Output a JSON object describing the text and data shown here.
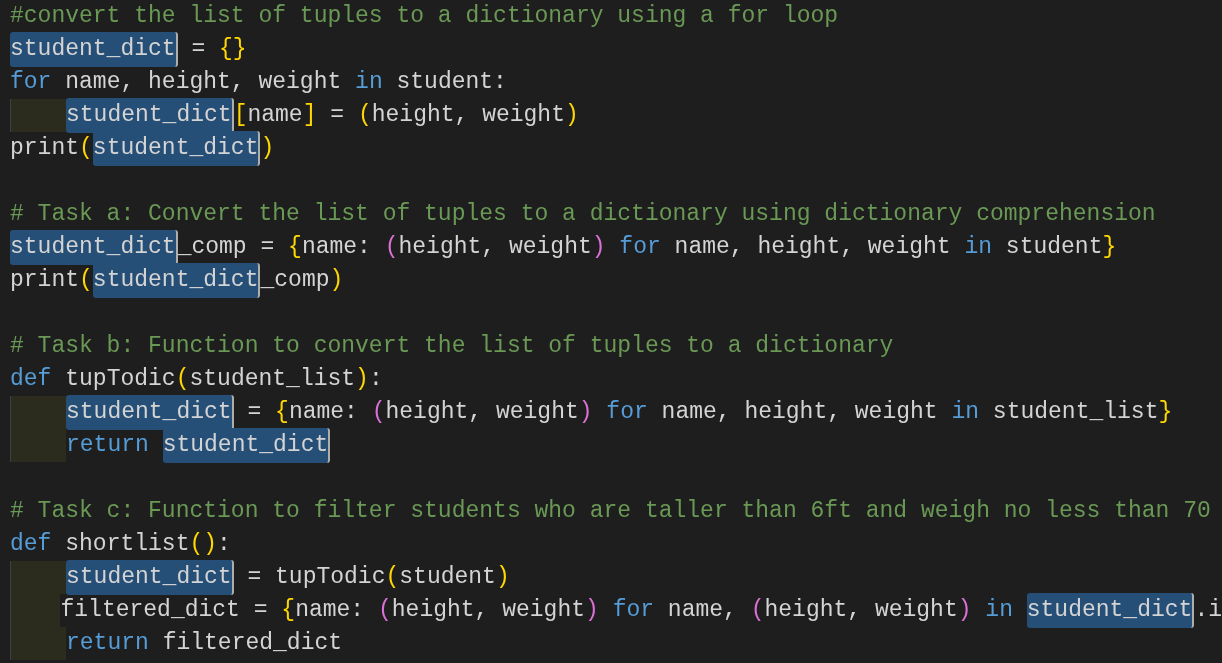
{
  "lines": [
    {
      "kind": "code",
      "tokens": [
        {
          "kind": "comment",
          "text": "#convert the list of tuples to a dictionary using a for loop"
        }
      ]
    },
    {
      "kind": "code",
      "tokens": [
        {
          "kind": "match",
          "text": "student_dict"
        },
        {
          "kind": "plain",
          "text": " = "
        },
        {
          "kind": "bracket1",
          "text": "{}"
        }
      ]
    },
    {
      "kind": "code",
      "tokens": [
        {
          "kind": "keyword",
          "text": "for"
        },
        {
          "kind": "plain",
          "text": " name, height, weight "
        },
        {
          "kind": "keyword",
          "text": "in"
        },
        {
          "kind": "plain",
          "text": " student:"
        }
      ]
    },
    {
      "kind": "indented",
      "tokens": [
        {
          "kind": "match",
          "text": "student_dict"
        },
        {
          "kind": "bracket1",
          "text": "["
        },
        {
          "kind": "plain",
          "text": "name"
        },
        {
          "kind": "bracket1",
          "text": "]"
        },
        {
          "kind": "plain",
          "text": " = "
        },
        {
          "kind": "bracket1",
          "text": "("
        },
        {
          "kind": "plain",
          "text": "height, weight"
        },
        {
          "kind": "bracket1",
          "text": ")"
        }
      ]
    },
    {
      "kind": "code",
      "tokens": [
        {
          "kind": "plain",
          "text": "print"
        },
        {
          "kind": "bracket1",
          "text": "("
        },
        {
          "kind": "match",
          "text": "student_dict"
        },
        {
          "kind": "bracket1",
          "text": ")"
        }
      ]
    },
    {
      "kind": "blank"
    },
    {
      "kind": "code",
      "tokens": [
        {
          "kind": "comment",
          "text": "# Task a: Convert the list of tuples to a dictionary using dictionary comprehension"
        }
      ]
    },
    {
      "kind": "code",
      "tokens": [
        {
          "kind": "match",
          "text": "student_dict"
        },
        {
          "kind": "plain",
          "text": "_comp = "
        },
        {
          "kind": "bracket1",
          "text": "{"
        },
        {
          "kind": "plain",
          "text": "name: "
        },
        {
          "kind": "bracket2",
          "text": "("
        },
        {
          "kind": "plain",
          "text": "height, weight"
        },
        {
          "kind": "bracket2",
          "text": ") "
        },
        {
          "kind": "keyword",
          "text": "for"
        },
        {
          "kind": "plain",
          "text": " name, height, weight "
        },
        {
          "kind": "keyword",
          "text": "in"
        },
        {
          "kind": "plain",
          "text": " student"
        },
        {
          "kind": "bracket1",
          "text": "}"
        }
      ]
    },
    {
      "kind": "code",
      "tokens": [
        {
          "kind": "plain",
          "text": "print"
        },
        {
          "kind": "bracket1",
          "text": "("
        },
        {
          "kind": "match",
          "text": "student_dict"
        },
        {
          "kind": "plain",
          "text": "_comp"
        },
        {
          "kind": "bracket1",
          "text": ")"
        }
      ]
    },
    {
      "kind": "blank"
    },
    {
      "kind": "code",
      "tokens": [
        {
          "kind": "comment",
          "text": "# Task b: Function to convert the list of tuples to a dictionary"
        }
      ]
    },
    {
      "kind": "code",
      "tokens": [
        {
          "kind": "keyword",
          "text": "def"
        },
        {
          "kind": "plain",
          "text": " tupTodic"
        },
        {
          "kind": "bracket1",
          "text": "("
        },
        {
          "kind": "plain",
          "text": "student_list"
        },
        {
          "kind": "bracket1",
          "text": ")"
        },
        {
          "kind": "plain",
          "text": ":"
        }
      ]
    },
    {
      "kind": "indented",
      "tokens": [
        {
          "kind": "match",
          "text": "student_dict"
        },
        {
          "kind": "plain",
          "text": " = "
        },
        {
          "kind": "bracket1",
          "text": "{"
        },
        {
          "kind": "plain",
          "text": "name: "
        },
        {
          "kind": "bracket2",
          "text": "("
        },
        {
          "kind": "plain",
          "text": "height, weight"
        },
        {
          "kind": "bracket2",
          "text": ") "
        },
        {
          "kind": "keyword",
          "text": "for"
        },
        {
          "kind": "plain",
          "text": " name, height, weight "
        },
        {
          "kind": "keyword",
          "text": "in"
        },
        {
          "kind": "plain",
          "text": " student_list"
        },
        {
          "kind": "bracket1",
          "text": "}"
        }
      ]
    },
    {
      "kind": "indented",
      "tokens": [
        {
          "kind": "keyword",
          "text": "return "
        },
        {
          "kind": "match",
          "text": "student_dict"
        }
      ]
    },
    {
      "kind": "blank"
    },
    {
      "kind": "code",
      "tokens": [
        {
          "kind": "comment",
          "text": "# Task c: Function to filter students who are taller than 6ft and weigh no less than 70"
        }
      ]
    },
    {
      "kind": "code",
      "tokens": [
        {
          "kind": "keyword",
          "text": "def"
        },
        {
          "kind": "plain",
          "text": " shortlist"
        },
        {
          "kind": "bracket1",
          "text": "()"
        },
        {
          "kind": "plain",
          "text": ":"
        }
      ]
    },
    {
      "kind": "indented",
      "tokens": [
        {
          "kind": "match",
          "text": "student_dict"
        },
        {
          "kind": "plain",
          "text": " = tupTodic"
        },
        {
          "kind": "bracket1",
          "text": "("
        },
        {
          "kind": "plain",
          "text": "student"
        },
        {
          "kind": "bracket1",
          "text": ")"
        }
      ]
    },
    {
      "kind": "indented",
      "tokens": [
        {
          "kind": "plain",
          "text": "filtered_dict = "
        },
        {
          "kind": "bracket1",
          "text": "{"
        },
        {
          "kind": "plain",
          "text": "name: "
        },
        {
          "kind": "bracket2",
          "text": "("
        },
        {
          "kind": "plain",
          "text": "height, weight"
        },
        {
          "kind": "bracket2",
          "text": ") "
        },
        {
          "kind": "keyword",
          "text": "for"
        },
        {
          "kind": "plain",
          "text": " name, "
        },
        {
          "kind": "bracket2",
          "text": "("
        },
        {
          "kind": "plain",
          "text": "height, weight"
        },
        {
          "kind": "bracket2",
          "text": ") "
        },
        {
          "kind": "keyword",
          "text": "in "
        },
        {
          "kind": "match",
          "text": "student_dict"
        },
        {
          "kind": "plain",
          "text": ".i"
        }
      ]
    },
    {
      "kind": "indented",
      "tokens": [
        {
          "kind": "keyword",
          "text": "return"
        },
        {
          "kind": "plain",
          "text": " filtered_dict"
        }
      ]
    }
  ]
}
